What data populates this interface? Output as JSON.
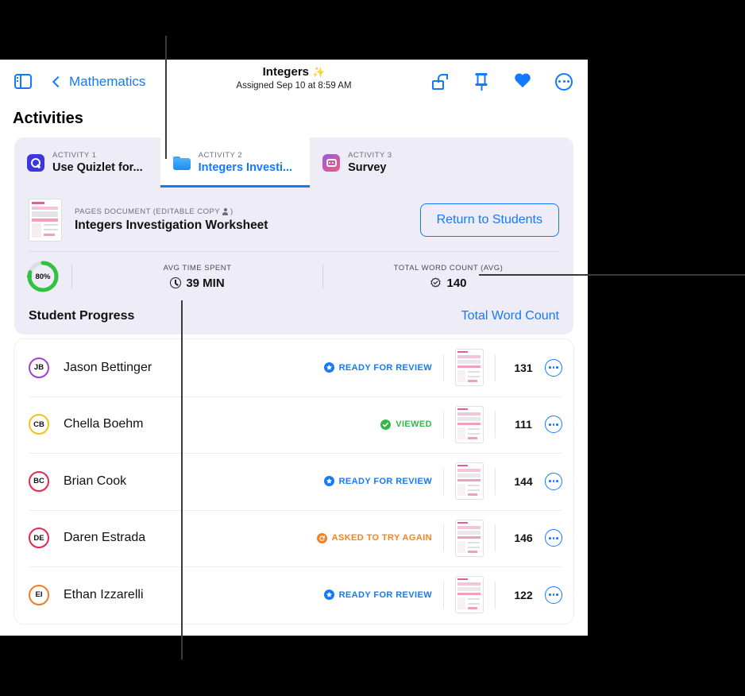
{
  "window": {
    "back_label": "Mathematics",
    "title": "Integers",
    "title_emoji": "✨",
    "subtitle": "Assigned Sep 10 at 8:59 AM",
    "sidebar_icon": "sidebar-icon",
    "back_icon": "chevron-left-icon",
    "toolbar_icons": [
      "unlock-icon",
      "pin-icon",
      "heart-icon",
      "more-options-icon"
    ]
  },
  "section": {
    "activities_heading": "Activities"
  },
  "tabs": [
    {
      "kicker": "ACTIVITY 1",
      "label": "Use Quizlet for...",
      "icon": "quizlet-icon",
      "active": false
    },
    {
      "kicker": "ACTIVITY 2",
      "label": "Integers Investi...",
      "icon": "pages-folder-icon",
      "active": true
    },
    {
      "kicker": "ACTIVITY 3",
      "label": "Survey",
      "icon": "survey-icon",
      "active": false
    }
  ],
  "document": {
    "kicker": "PAGES DOCUMENT (EDITABLE COPY",
    "kicker_suffix": ")",
    "title": "Integers Investigation Worksheet",
    "return_button": "Return to Students",
    "thumbnail_icon": "document-thumbnail"
  },
  "stats": {
    "ring_percent": "80%",
    "ring_value": 80,
    "ring_color": "#30c240",
    "items": [
      {
        "label": "AVG TIME SPENT",
        "value": "39 MIN",
        "icon": "clock-icon"
      },
      {
        "label": "TOTAL WORD COUNT (AVG)",
        "value": "140",
        "icon": "seal-check-icon"
      }
    ]
  },
  "student_progress": {
    "title": "Student Progress",
    "link": "Total Word Count"
  },
  "students": [
    {
      "initials": "JB",
      "name": "Jason Bettinger",
      "ring": "#a43fd6",
      "status": "READY FOR REVIEW",
      "status_color": "#1479ff",
      "status_icon": "ready-for-review-icon",
      "count": "131",
      "more_icon": "more-options-icon",
      "thumb_icon": "document-thumbnail"
    },
    {
      "initials": "CB",
      "name": "Chella Boehm",
      "ring": "#f5bf1e",
      "status": "VIEWED",
      "status_color": "#34b84a",
      "status_icon": "viewed-check-icon",
      "count": "111",
      "more_icon": "more-options-icon",
      "thumb_icon": "document-thumbnail"
    },
    {
      "initials": "BC",
      "name": "Brian Cook",
      "ring": "#e8264f",
      "status": "READY FOR REVIEW",
      "status_color": "#1479ff",
      "status_icon": "ready-for-review-icon",
      "count": "144",
      "more_icon": "more-options-icon",
      "thumb_icon": "document-thumbnail"
    },
    {
      "initials": "DE",
      "name": "Daren Estrada",
      "ring": "#e8264f",
      "status": "ASKED TO TRY AGAIN",
      "status_color": "#f58220",
      "status_icon": "try-again-icon",
      "count": "146",
      "more_icon": "more-options-icon",
      "thumb_icon": "document-thumbnail"
    },
    {
      "initials": "EI",
      "name": "Ethan Izzarelli",
      "ring": "#f07d22",
      "status": "READY FOR REVIEW",
      "status_color": "#1479ff",
      "status_icon": "ready-for-review-icon",
      "count": "122",
      "more_icon": "more-options-icon",
      "thumb_icon": "document-thumbnail"
    }
  ],
  "annotations": {
    "callout_lines": [
      "callout-line-top",
      "callout-line-bottom",
      "callout-line-right"
    ]
  }
}
